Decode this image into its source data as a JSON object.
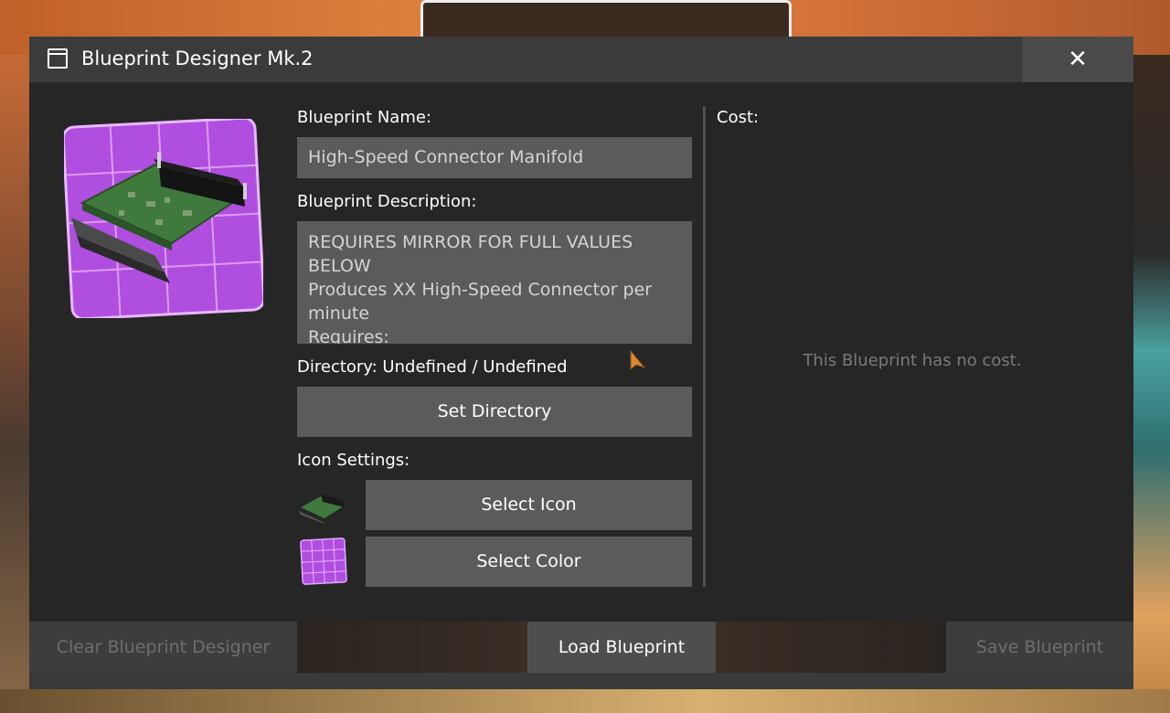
{
  "window": {
    "title": "Blueprint Designer Mk.2",
    "close_label": "✕"
  },
  "form": {
    "name_label": "Blueprint Name:",
    "name_value": "High-Speed Connector Manifold",
    "description_label": "Blueprint Description:",
    "description_lines": [
      "REQUIRES MIRROR FOR FULL VALUES BELOW",
      "Produces XX High-Speed Connector per",
      "minute",
      "Requires:"
    ],
    "directory_label": "Directory: Undefined / Undefined",
    "set_directory_label": "Set Directory",
    "icon_settings_label": "Icon Settings:",
    "select_icon_label": "Select Icon",
    "select_color_label": "Select Color"
  },
  "cost": {
    "label": "Cost:",
    "empty_text": "This Blueprint has no cost."
  },
  "bottom": {
    "clear_label": "Clear Blueprint Designer",
    "load_label": "Load Blueprint",
    "save_label": "Save Blueprint"
  },
  "colors": {
    "icon_background": "#b04ee0",
    "panel": "#262626",
    "input": "#5b5b5b"
  }
}
